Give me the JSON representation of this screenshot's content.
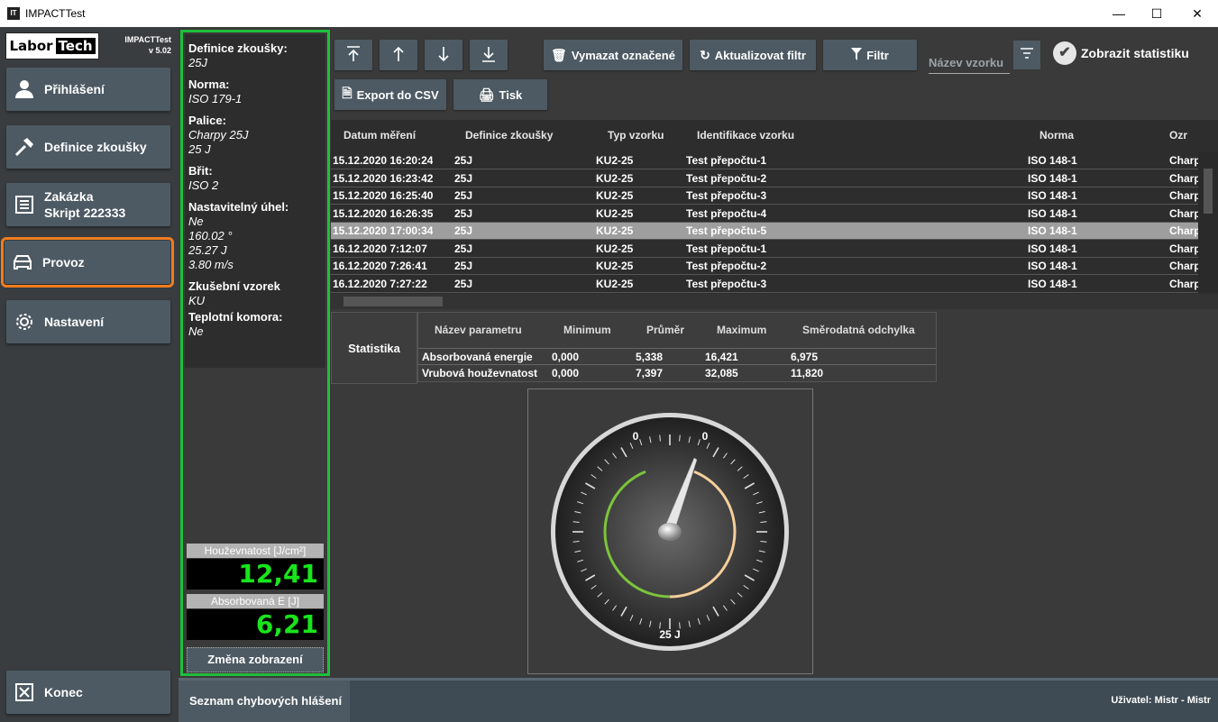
{
  "app": {
    "title": "IMPACTTest",
    "brand_left": "Labor",
    "brand_right": "Tech",
    "version_name": "IMPACTTest",
    "version": "v 5.02"
  },
  "nav": [
    {
      "label": "Přihlášení",
      "icon": "user-icon"
    },
    {
      "label": "Definice zkoušky",
      "icon": "hammer-icon"
    },
    {
      "label": "Zakázka",
      "label2": "Skript 222333",
      "icon": "list-icon"
    },
    {
      "label": "Provoz",
      "icon": "car-icon",
      "active": true
    },
    {
      "label": "Nastavení",
      "icon": "gear-icon"
    }
  ],
  "exit_label": "Konec",
  "info": {
    "definition_label": "Definice zkoušky:",
    "definition_value": "25J",
    "norm_label": "Norma:",
    "norm_value": "ISO 179-1",
    "hammer_label": "Palice:",
    "hammer_value1": "Charpy 25J",
    "hammer_value2": "25 J",
    "blade_label": "Břit:",
    "blade_value": "ISO 2",
    "angle_label": "Nastavitelný úhel:",
    "angle_value1": "Ne",
    "angle_value2": "160.02 °",
    "angle_value3": "25.27 J",
    "angle_value4": "3.80 m/s",
    "specimen_label": "Zkušební vzorek",
    "specimen_value": "KU",
    "chamber_label": "Teplotní komora:",
    "chamber_value": "Ne"
  },
  "readouts": {
    "toughness_label": "Houževnatost [J/cm²]",
    "toughness_value": "12,41",
    "energy_label": "Absorbovaná E [J]",
    "energy_value": "6,21",
    "change_view": "Změna zobrazení"
  },
  "toolbar": {
    "delete_selected": "Vymazat označené",
    "refresh_filter": "Aktualizovat filtr",
    "filter": "Filtr",
    "sample_name_placeholder": "Název vzorku",
    "show_statistics": "Zobrazit statistiku",
    "export_csv": "Export do CSV",
    "print": "Tisk"
  },
  "grid": {
    "columns": [
      "Datum měření",
      "Definice zkoušky",
      "Typ vzorku",
      "Identifikace vzorku",
      "Norma",
      "Ozr"
    ],
    "rows": [
      [
        "15.12.2020 16:20:24",
        "25J",
        "KU2-25",
        "Test přepočtu-1",
        "ISO 148-1",
        "Charp"
      ],
      [
        "15.12.2020 16:23:42",
        "25J",
        "KU2-25",
        "Test přepočtu-2",
        "ISO 148-1",
        "Charp"
      ],
      [
        "15.12.2020 16:25:40",
        "25J",
        "KU2-25",
        "Test přepočtu-3",
        "ISO 148-1",
        "Charp"
      ],
      [
        "15.12.2020 16:26:35",
        "25J",
        "KU2-25",
        "Test přepočtu-4",
        "ISO 148-1",
        "Charp"
      ],
      [
        "15.12.2020 17:00:34",
        "25J",
        "KU2-25",
        "Test přepočtu-5",
        "ISO 148-1",
        "Charp"
      ],
      [
        "16.12.2020 7:12:07",
        "25J",
        "KU2-25",
        "Test přepočtu-1",
        "ISO 148-1",
        "Charp"
      ],
      [
        "16.12.2020 7:26:41",
        "25J",
        "KU2-25",
        "Test přepočtu-2",
        "ISO 148-1",
        "Charp"
      ],
      [
        "16.12.2020 7:27:22",
        "25J",
        "KU2-25",
        "Test přepočtu-3",
        "ISO 148-1",
        "Charp"
      ]
    ],
    "selected_row": 4
  },
  "stats": {
    "label": "Statistika",
    "headers": [
      "Název parametru",
      "Minimum",
      "Průměr",
      "Maximum",
      "Směrodatná odchylka"
    ],
    "rows": [
      [
        "Absorbovaná energie",
        "0,000",
        "5,338",
        "16,421",
        "6,975"
      ],
      [
        "Vrubová houževnatost",
        "0,000",
        "7,397",
        "32,085",
        "11,820"
      ]
    ]
  },
  "gauge": {
    "left_value": "0",
    "right_value": "0",
    "unit_label": "25 J",
    "colors": {
      "green": "#7cc43c",
      "peach": "#f5cf9b"
    }
  },
  "status": {
    "error_list": "Seznam chybových hlášení",
    "user": "Uživatel: Mistr  -  Mistr"
  },
  "colors": {
    "accent_green": "#1fbf3c",
    "active_orange": "#f07d1f",
    "button": "#4d5a63",
    "readout": "#18e51c"
  }
}
